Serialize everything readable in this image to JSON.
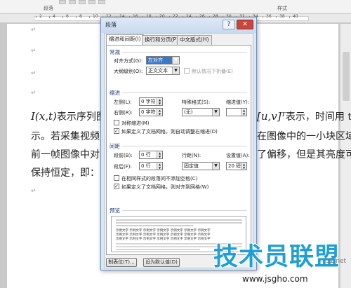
{
  "ribbon": {
    "group_paragraph": "段落",
    "group_styles": "样式"
  },
  "ruler_numbers": [
    "2",
    "4",
    "6",
    "8",
    "10",
    "12",
    "14",
    "16",
    "18",
    "20",
    "22",
    "24",
    "26",
    "28",
    "30",
    "32",
    "34",
    "36",
    "38",
    "40"
  ],
  "doc": {
    "line1_math": "I(x,t)",
    "line1_a": "表示序列图",
    "line1_b": "表示，时间用 t",
    "line1_math2": "[u,v]ᵀ",
    "line2_a": "示。若采集视频",
    "line2_b": "在图像中的一小块区域",
    "line3_a": "前一帧图像中对",
    "line3_b": "了偏移，但是其亮度可",
    "line4_a": "保持恒定，即：",
    "para_mark": "↵"
  },
  "dialog": {
    "title": "段落",
    "help": "?",
    "close": "✕",
    "tabs": [
      {
        "label": "缩进和间距(I)"
      },
      {
        "label": "换行和分页(P)"
      },
      {
        "label": "中文版式(H)"
      }
    ],
    "general": {
      "heading": "常规",
      "alignment_label": "对齐方式(G):",
      "alignment_value": "左对齐",
      "outline_label": "大纲级别(O):",
      "outline_value": "正文文本",
      "collapse_label": "默认情况下折叠(E)"
    },
    "indent": {
      "heading": "缩进",
      "left_label": "左侧(L):",
      "left_value": "0 字符",
      "right_label": "右侧(R):",
      "right_value": "0 字符",
      "special_label": "特殊格式(S):",
      "special_value": "(无)",
      "by_label": "缩进值(Y):",
      "mirror_label": "对称缩进(M)",
      "grid_label": "如果定义了文档网格，则自动调整右缩进(D)",
      "grid_check": "✓"
    },
    "spacing": {
      "heading": "间距",
      "before_label": "段前(B):",
      "before_value": "0 行",
      "after_label": "段后(F):",
      "after_value": "0 行",
      "line_label": "行距(N):",
      "line_value": "固定值",
      "at_label": "设置值(A):",
      "at_value": "20 磅",
      "no_space_label": "在相同样式的段落间不添加空格(C)",
      "snap_label": "如果定义了文档网格，则对齐到网格(W)",
      "snap_check": "✓"
    },
    "preview": {
      "heading": "预览",
      "sample": "示例文字 示例文字 示例文字 示例文字 示例文字 示例文字 示例文字"
    },
    "buttons": {
      "tabs": "制表位(T)...",
      "default": "设为默认值(D)"
    }
  },
  "watermark": {
    "main": "技术员联盟",
    "url": "www.jsgho.com",
    "side": "51.net"
  },
  "colors": {
    "title_blue": "#1e3a78",
    "watermark_blue": "#1f9fd6",
    "selection_blue": "#3b78c8"
  }
}
